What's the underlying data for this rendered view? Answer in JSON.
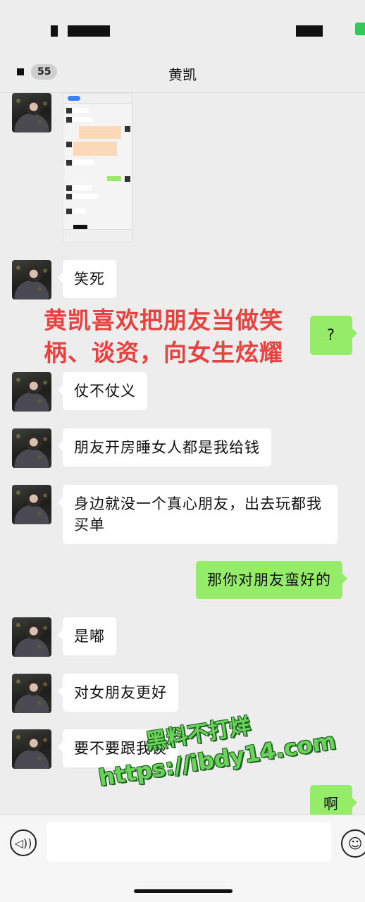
{
  "nav": {
    "back_badge": "55",
    "title": "黄凯"
  },
  "messages": [
    {
      "side": "left",
      "type": "image",
      "text": ""
    },
    {
      "side": "left",
      "type": "text",
      "text": "笑死"
    },
    {
      "side": "right",
      "type": "text",
      "text": "?"
    },
    {
      "side": "left",
      "type": "text",
      "text": "仗不仗义"
    },
    {
      "side": "left",
      "type": "text",
      "text": "朋友开房睡女人都是我给钱"
    },
    {
      "side": "left",
      "type": "text",
      "text": "身边就没一个真心朋友，出去玩都我买单"
    },
    {
      "side": "right",
      "type": "text",
      "text": "那你对朋友蛮好的"
    },
    {
      "side": "left",
      "type": "text",
      "text": "是嘟"
    },
    {
      "side": "left",
      "type": "text",
      "text": "对女朋友更好"
    },
    {
      "side": "left",
      "type": "text",
      "text": "要不要跟我谈"
    },
    {
      "side": "right",
      "type": "text",
      "text": "啊"
    }
  ],
  "caption": {
    "line1": "黄凯喜欢把朋友当做笑",
    "line2": "柄、谈资，向女生炫耀",
    "color": "#e8423f"
  },
  "watermark": {
    "line1": "黑料不打烊",
    "line2": "https://ibdy14.com",
    "color": "#6bd25a"
  },
  "input": {
    "placeholder": "",
    "voice_icon": "voice-icon",
    "emoji_icon": "emoji-icon"
  },
  "colors": {
    "background": "#ededed",
    "bubble_self": "#95ec69",
    "bubble_other": "#ffffff"
  }
}
